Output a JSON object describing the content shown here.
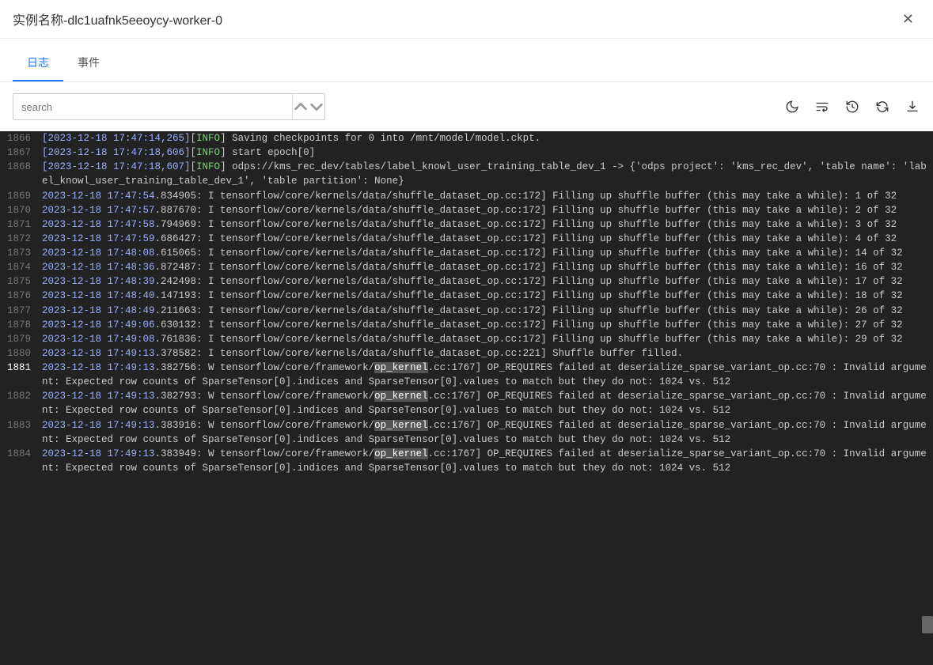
{
  "header": {
    "title": "实例名称-dlc1uafnk5eeoycy-worker-0"
  },
  "tabs": [
    {
      "label": "日志",
      "active": true
    },
    {
      "label": "事件",
      "active": false
    }
  ],
  "search": {
    "placeholder": "search"
  },
  "icons": [
    "moon-icon",
    "wrap-lines-icon",
    "refresh-history-icon",
    "refresh-icon",
    "download-icon"
  ],
  "logs": [
    {
      "n": 1866,
      "ts": "[2023-12-18 17:47:14,265]",
      "lvl": "INFO",
      "msg": " Saving checkpoints for 0 into /mnt/model/model.ckpt."
    },
    {
      "n": 1867,
      "ts": "[2023-12-18 17:47:18,606]",
      "lvl": "INFO",
      "msg": " start epoch[0]"
    },
    {
      "n": 1868,
      "ts": "[2023-12-18 17:47:18,607]",
      "lvl": "INFO",
      "msg": " odps://kms_rec_dev/tables/label_knowl_user_training_table_dev_1 -> {'odps project': 'kms_rec_dev', 'table name': 'label_knowl_user_training_table_dev_1', 'table partition': None}"
    },
    {
      "n": 1869,
      "ts": "2023-12-18 17:47:54",
      "rest": ".834905: I tensorflow/core/kernels/data/shuffle_dataset_op.cc:172] Filling up shuffle buffer (this may take a while): 1 of 32"
    },
    {
      "n": 1870,
      "ts": "2023-12-18 17:47:57",
      "rest": ".887670: I tensorflow/core/kernels/data/shuffle_dataset_op.cc:172] Filling up shuffle buffer (this may take a while): 2 of 32"
    },
    {
      "n": 1871,
      "ts": "2023-12-18 17:47:58",
      "rest": ".794969: I tensorflow/core/kernels/data/shuffle_dataset_op.cc:172] Filling up shuffle buffer (this may take a while): 3 of 32"
    },
    {
      "n": 1872,
      "ts": "2023-12-18 17:47:59",
      "rest": ".686427: I tensorflow/core/kernels/data/shuffle_dataset_op.cc:172] Filling up shuffle buffer (this may take a while): 4 of 32"
    },
    {
      "n": 1873,
      "ts": "2023-12-18 17:48:08",
      "rest": ".615065: I tensorflow/core/kernels/data/shuffle_dataset_op.cc:172] Filling up shuffle buffer (this may take a while): 14 of 32"
    },
    {
      "n": 1874,
      "ts": "2023-12-18 17:48:36",
      "rest": ".872487: I tensorflow/core/kernels/data/shuffle_dataset_op.cc:172] Filling up shuffle buffer (this may take a while): 16 of 32"
    },
    {
      "n": 1875,
      "ts": "2023-12-18 17:48:39",
      "rest": ".242498: I tensorflow/core/kernels/data/shuffle_dataset_op.cc:172] Filling up shuffle buffer (this may take a while): 17 of 32"
    },
    {
      "n": 1876,
      "ts": "2023-12-18 17:48:40",
      "rest": ".147193: I tensorflow/core/kernels/data/shuffle_dataset_op.cc:172] Filling up shuffle buffer (this may take a while): 18 of 32"
    },
    {
      "n": 1877,
      "ts": "2023-12-18 17:48:49",
      "rest": ".211663: I tensorflow/core/kernels/data/shuffle_dataset_op.cc:172] Filling up shuffle buffer (this may take a while): 26 of 32"
    },
    {
      "n": 1878,
      "ts": "2023-12-18 17:49:06",
      "rest": ".630132: I tensorflow/core/kernels/data/shuffle_dataset_op.cc:172] Filling up shuffle buffer (this may take a while): 27 of 32"
    },
    {
      "n": 1879,
      "ts": "2023-12-18 17:49:08",
      "rest": ".761836: I tensorflow/core/kernels/data/shuffle_dataset_op.cc:172] Filling up shuffle buffer (this may take a while): 29 of 32"
    },
    {
      "n": 1880,
      "ts": "2023-12-18 17:49:13",
      "rest": ".378582: I tensorflow/core/kernels/data/shuffle_dataset_op.cc:221] Shuffle buffer filled."
    },
    {
      "n": 1881,
      "ts": "2023-12-18 17:49:13",
      "sel": true,
      "pre": ".382756: W tensorflow/core/framework/",
      "hl": "op_kernel",
      "post": ".cc:1767] OP_REQUIRES failed at deserialize_sparse_variant_op.cc:70 : Invalid argument: Expected row counts of SparseTensor[0].indices and SparseTensor[0].values to match but they do not: 1024 vs. 512"
    },
    {
      "n": 1882,
      "ts": "2023-12-18 17:49:13",
      "pre": ".382793: W tensorflow/core/framework/",
      "hl": "op_kernel",
      "post": ".cc:1767] OP_REQUIRES failed at deserialize_sparse_variant_op.cc:70 : Invalid argument: Expected row counts of SparseTensor[0].indices and SparseTensor[0].values to match but they do not: 1024 vs. 512"
    },
    {
      "n": 1883,
      "ts": "2023-12-18 17:49:13",
      "pre": ".383916: W tensorflow/core/framework/",
      "hl": "op_kernel",
      "post": ".cc:1767] OP_REQUIRES failed at deserialize_sparse_variant_op.cc:70 : Invalid argument: Expected row counts of SparseTensor[0].indices and SparseTensor[0].values to match but they do not: 1024 vs. 512"
    },
    {
      "n": 1884,
      "ts": "2023-12-18 17:49:13",
      "pre": ".383949: W tensorflow/core/framework/",
      "hl": "op_kernel",
      "post": ".cc:1767] OP_REQUIRES failed at deserialize_sparse_variant_op.cc:70 : Invalid argument: Expected row counts of SparseTensor[0].indices and SparseTensor[0].values to match but they do not: 1024 vs. 512"
    }
  ]
}
